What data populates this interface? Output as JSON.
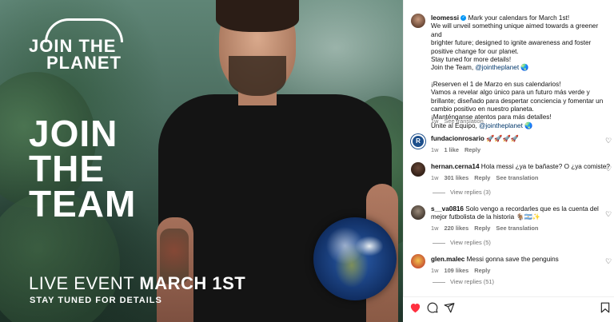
{
  "image": {
    "logo_line1": "JOIN THE",
    "logo_line2": "PLANET",
    "headline": [
      "JOIN",
      "THE",
      "TEAM"
    ],
    "event_prefix": "LIVE EVENT ",
    "event_date": "MARCH 1ST",
    "subline": "STAY TUNED FOR DETAILS"
  },
  "post": {
    "username": "leomessi",
    "verified": true,
    "caption_en": [
      " Mark your calendars for March 1st!",
      "We will unveil something unique aimed towards a greener and",
      "brighter future; designed to ignite awareness and foster",
      "positive change for our planet.",
      "Stay tuned for more details!",
      "Join the Team, "
    ],
    "mention": "@jointheplanet",
    "globe_emoji": "🌏",
    "caption_es": [
      "¡Reserven el 1 de Marzo en sus calendarios!",
      "Vamos a revelar algo único para un futuro más verde y",
      "brillante; diseñado para despertar conciencia y fomentar un",
      "cambio positivo en nuestro planeta.",
      "¡Manténganse atentos para más detalles!",
      "Unite al Equipo, "
    ],
    "time": "1w",
    "see_translation": "See translation"
  },
  "comments": [
    {
      "username": "fundacionrosario",
      "text": " 🚀🚀🚀🚀",
      "time": "1w",
      "likes": "1 like",
      "reply": "Reply",
      "see_translation": ""
    },
    {
      "username": "hernan.cerna14",
      "text": " Hola messi ¿ya te bañaste? O ¿ya comiste?",
      "time": "1w",
      "likes": "301 likes",
      "reply": "Reply",
      "see_translation": "See translation",
      "view_replies": "View replies (3)"
    },
    {
      "username": "s__va0816",
      "text_line1": " Solo vengo a recordarles que es la cuenta del",
      "text_line2": "mejor futbolista de la historia 🐐🇦🇷✨",
      "time": "1w",
      "likes": "220 likes",
      "reply": "Reply",
      "see_translation": "See translation",
      "view_replies": "View replies (5)"
    },
    {
      "username": "glen.malec",
      "text": " Messi gonna save the penguins",
      "time": "1w",
      "likes": "109 likes",
      "reply": "Reply",
      "view_replies": "View replies (51)"
    }
  ],
  "colors": {
    "accent_blue": "#0095f6",
    "mention": "#00376b",
    "heart_red": "#ff3040",
    "meta_gray": "#737373"
  },
  "icons": {
    "like": "heart-icon",
    "comment": "comment-icon",
    "share": "share-icon",
    "save": "bookmark-icon"
  }
}
